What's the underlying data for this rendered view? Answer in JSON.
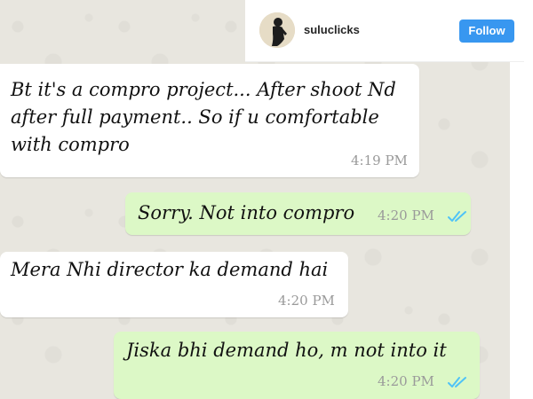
{
  "header": {
    "username": "suluclicks",
    "follow_label": "Follow",
    "avatar_icon": "profile-avatar",
    "follow_color": "#3897f0"
  },
  "chat": {
    "background_color": "#e8e6df",
    "incoming_color": "#ffffff",
    "outgoing_color": "#dcf8c6",
    "read_tick_color": "#4fc3f7",
    "messages": [
      {
        "direction": "incoming",
        "text": "Bt it's a compro project... After shoot Nd\nafter full payment.. So if u comfortable\nwith compro",
        "time": "4:19 PM"
      },
      {
        "direction": "outgoing",
        "text": "Sorry. Not into compro",
        "time": "4:20 PM",
        "status_icon": "double-check-icon"
      },
      {
        "direction": "incoming",
        "text": "Mera Nhi director ka demand hai",
        "time": "4:20 PM"
      },
      {
        "direction": "outgoing",
        "text": "Jiska bhi demand ho, m not into it",
        "time": "4:20 PM",
        "status_icon": "double-check-icon"
      }
    ]
  }
}
